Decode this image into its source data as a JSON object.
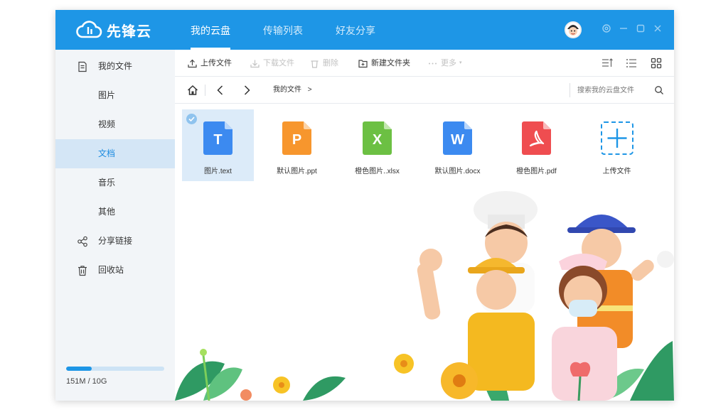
{
  "app": {
    "name": "先锋云"
  },
  "nav": {
    "tabs": [
      {
        "label": "我的云盘",
        "active": true
      },
      {
        "label": "传输列表",
        "active": false
      },
      {
        "label": "好友分享",
        "active": false
      }
    ]
  },
  "sidebar": {
    "items": [
      {
        "label": "我的文件",
        "icon": "document-icon"
      },
      {
        "label": "图片"
      },
      {
        "label": "视频"
      },
      {
        "label": "文档",
        "active": true
      },
      {
        "label": "音乐"
      },
      {
        "label": "其他"
      },
      {
        "label": "分享链接",
        "icon": "share-icon"
      },
      {
        "label": "回收站",
        "icon": "trash-icon"
      }
    ],
    "storage": {
      "text": "151M / 10G",
      "used_fraction": 0.26
    }
  },
  "toolbar": {
    "upload": "上传文件",
    "download": "下载文件",
    "delete": "删除",
    "new_folder": "新建文件夹",
    "more": "更多"
  },
  "pathbar": {
    "breadcrumb": "我的文件",
    "search_placeholder": "搜索我的云盘文件"
  },
  "files": [
    {
      "name": "图片.text",
      "letter": "T",
      "color": "#3c8af0",
      "selected": true
    },
    {
      "name": "默认图片.ppt",
      "letter": "P",
      "color": "#f7962d"
    },
    {
      "name": "橙色图片..xlsx",
      "letter": "X",
      "color": "#6cc043"
    },
    {
      "name": "默认图片.docx",
      "letter": "W",
      "color": "#3c8af0"
    },
    {
      "name": "橙色图片.pdf",
      "letter": "pdf",
      "color": "#ef4d50"
    },
    {
      "name": "上传文件",
      "letter": "+",
      "color": "#1e96e6"
    }
  ],
  "colors": {
    "accent": "#1e96e6",
    "sidebar_active": "#d4e6f6"
  }
}
